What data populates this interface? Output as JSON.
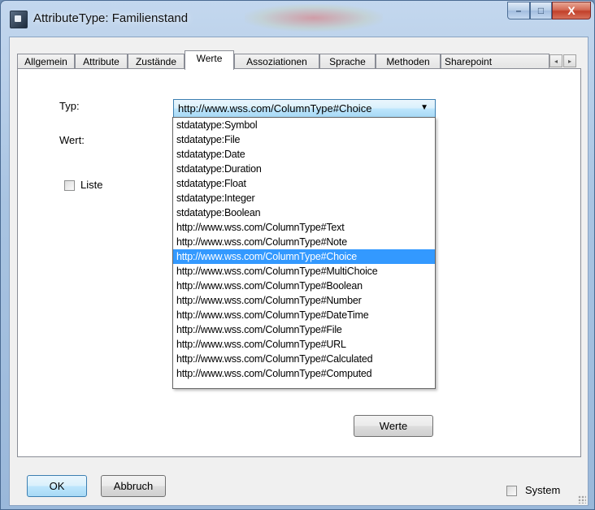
{
  "window": {
    "title": "AttributeType: Familienstand",
    "min_label": "–",
    "max_label": "□",
    "close_label": "X"
  },
  "tabs": [
    {
      "label": "Allgemein"
    },
    {
      "label": "Attribute"
    },
    {
      "label": "Zustände"
    },
    {
      "label": "Werte"
    },
    {
      "label": "Assoziationen"
    },
    {
      "label": "Sprache"
    },
    {
      "label": "Methoden"
    },
    {
      "label": "Sharepoint"
    }
  ],
  "tab_scroll": {
    "left": "◂",
    "right": "▸"
  },
  "form": {
    "typ_label": "Typ:",
    "wert_label": "Wert:",
    "liste_label": "Liste",
    "typ_selected": "http://www.wss.com/ColumnType#Choice",
    "combo_arrow": "▼",
    "typ_options": [
      "stdatatype:Symbol",
      "stdatatype:File",
      "stdatatype:Date",
      "stdatatype:Duration",
      "stdatatype:Float",
      "stdatatype:Integer",
      "stdatatype:Boolean",
      "http://www.wss.com/ColumnType#Text",
      "http://www.wss.com/ColumnType#Note",
      "http://www.wss.com/ColumnType#Choice",
      "http://www.wss.com/ColumnType#MultiChoice",
      "http://www.wss.com/ColumnType#Boolean",
      "http://www.wss.com/ColumnType#Number",
      "http://www.wss.com/ColumnType#DateTime",
      "http://www.wss.com/ColumnType#File",
      "http://www.wss.com/ColumnType#URL",
      "http://www.wss.com/ColumnType#Calculated",
      "http://www.wss.com/ColumnType#Computed"
    ],
    "werte_button": "Werte"
  },
  "footer": {
    "ok": "OK",
    "cancel": "Abbruch",
    "system_label": "System"
  }
}
